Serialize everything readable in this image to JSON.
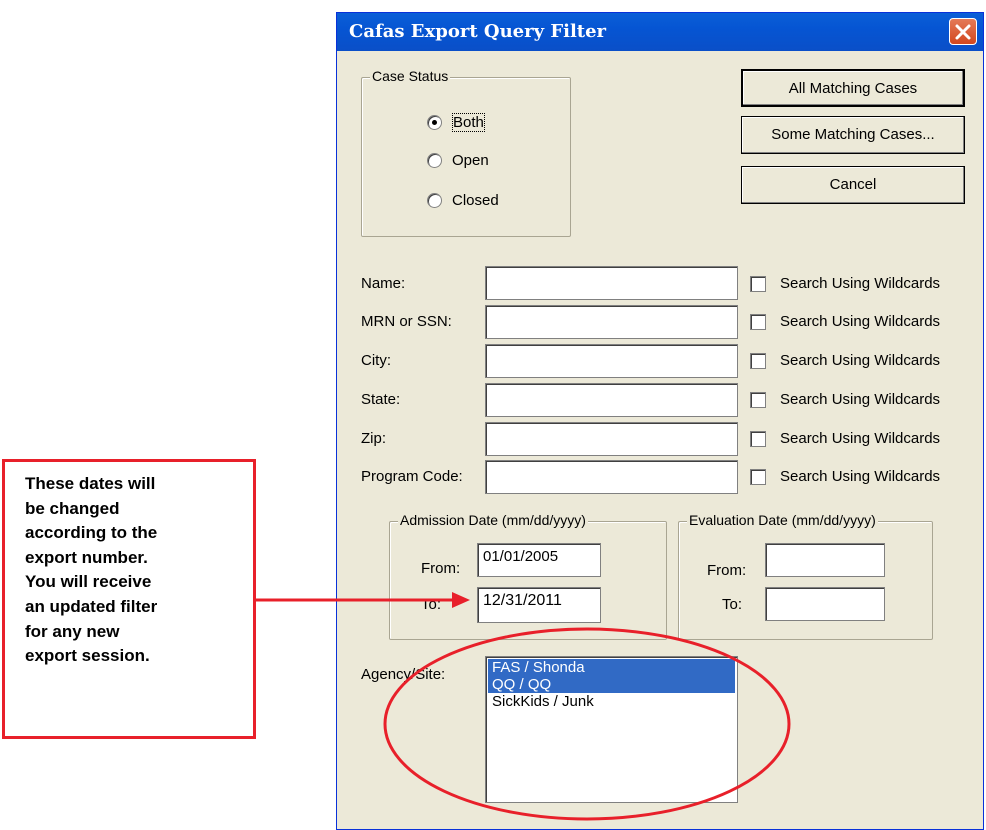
{
  "annotation": {
    "text": "These dates will\nbe changed\naccording to the\nexport number.\nYou will receive\nan updated filter\nfor any new\nexport session.",
    "border_color": "#e8202a"
  },
  "dialog": {
    "title": "Cafas Export Query Filter",
    "close_icon": "close-x-icon"
  },
  "case_status": {
    "legend": "Case Status",
    "options": [
      {
        "label": "Both",
        "selected": true
      },
      {
        "label": "Open",
        "selected": false
      },
      {
        "label": "Closed",
        "selected": false
      }
    ]
  },
  "buttons": {
    "all_matching": "All Matching Cases",
    "some_matching": "Some Matching Cases...",
    "cancel": "Cancel"
  },
  "fields": [
    {
      "label": "Name:",
      "value": "",
      "wildcard_label": "Search Using Wildcards",
      "wildcard_checked": false
    },
    {
      "label": "MRN or SSN:",
      "value": "",
      "wildcard_label": "Search Using Wildcards",
      "wildcard_checked": false
    },
    {
      "label": "City:",
      "value": "",
      "wildcard_label": "Search Using Wildcards",
      "wildcard_checked": false
    },
    {
      "label": "State:",
      "value": "",
      "wildcard_label": "Search Using Wildcards",
      "wildcard_checked": false
    },
    {
      "label": "Zip:",
      "value": "",
      "wildcard_label": "Search Using Wildcards",
      "wildcard_checked": false
    },
    {
      "label": "Program Code:",
      "value": "",
      "wildcard_label": "Search Using Wildcards",
      "wildcard_checked": false
    }
  ],
  "admission_date": {
    "legend": "Admission Date (mm/dd/yyyy)",
    "from_label": "From:",
    "from_value": "01/01/2005",
    "to_label": "To:",
    "to_value": "12/31/2011"
  },
  "evaluation_date": {
    "legend": "Evaluation Date (mm/dd/yyyy)",
    "from_label": "From:",
    "from_value": "",
    "to_label": "To:",
    "to_value": ""
  },
  "agency_site": {
    "label": "Agency/Site:",
    "items": [
      {
        "label": "FAS / Shonda",
        "selected": true
      },
      {
        "label": "QQ / QQ",
        "selected": true
      },
      {
        "label": "SickKids / Junk",
        "selected": false
      }
    ]
  },
  "colors": {
    "titlebar": "#0655d3",
    "dialog_bg": "#ece9d8",
    "selection": "#316ac5",
    "annotation_red": "#e8202a"
  }
}
